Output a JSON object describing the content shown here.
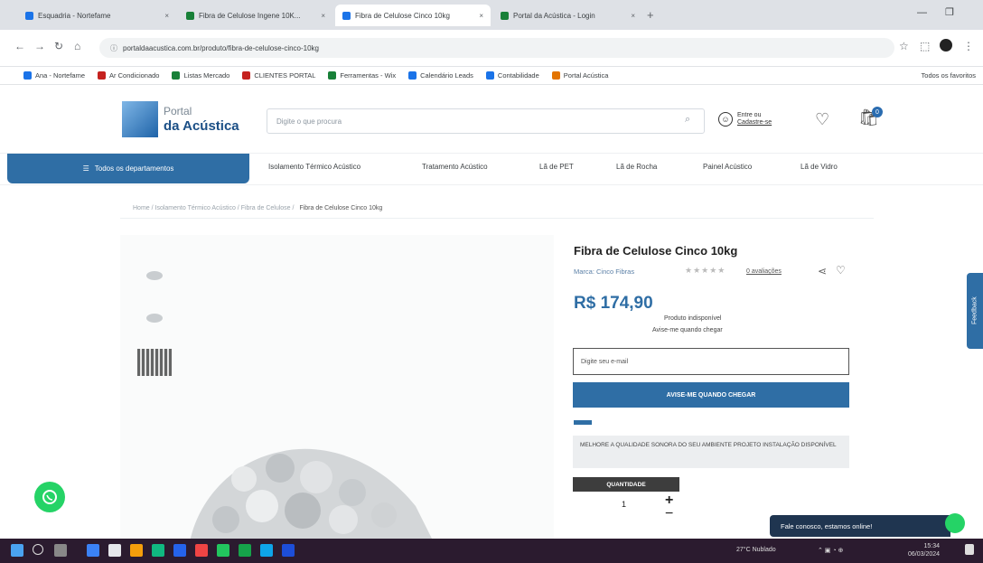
{
  "browser": {
    "tabs": [
      {
        "label": "Esquadria - Nortefame",
        "color": "#1a73e8"
      },
      {
        "label": "Fibra de Celulose Ingene 10K...",
        "color": "#188038"
      },
      {
        "label": "Fibra de Celulose Cinco 10kg",
        "color": "#1a73e8"
      },
      {
        "label": "Portal da Acústica - Login",
        "color": "#188038"
      }
    ],
    "new_tab": "+",
    "url": "portaldaacustica.com.br/produto/fibra-de-celulose-cinco-10kg",
    "bookmarks": [
      "Ana - Nortefame",
      "Ar Condicionado",
      "Listas Mercado",
      "CLIENTES PORTAL",
      "Ferramentas - Wix",
      "Calendário Leads",
      "Contabilidade",
      "Portal Acústica",
      "Todos os favoritos"
    ]
  },
  "header": {
    "logo_line1": "Portal",
    "logo_line2": "da Acústica",
    "search_placeholder": "Digite o que procura",
    "account_line1": "Entre ou",
    "account_line2": "Cadastre-se",
    "cart_count": "0"
  },
  "nav": {
    "departments": "Todos os departamentos",
    "items": [
      "Isolamento Térmico Acústico",
      "Tratamento Acústico",
      "Lã de PET",
      "Lã de Rocha",
      "Painel Acústico",
      "Lã de Vidro"
    ]
  },
  "breadcrumb": {
    "path": "Home / Isolamento Térmico Acústico / Fibra de Celulose / ",
    "current": "Fibra de Celulose Cinco 10kg"
  },
  "product": {
    "title": "Fibra de Celulose Cinco 10kg",
    "brand": "Marca: Cinco Fibras",
    "stars": "★★★★★",
    "reviews": "0 avaliações",
    "price": "R$ 174,90",
    "availability_line1": "Produto indisponível",
    "availability_line2": "Avise-me quando chegar",
    "notify_placeholder": "Digite seu e-mail",
    "notify_button": "AVISE-ME QUANDO CHEGAR",
    "info_text": "MELHORE A QUALIDADE SONORA DO SEU AMBIENTE PROJETO INSTALAÇÃO DISPONÍVEL",
    "quantity_label": "QUANTIDADE",
    "quantity": "1",
    "plus": "+",
    "minus": "−"
  },
  "widgets": {
    "feedback": "Feedback",
    "chat": "Fale conosco, estamos online!"
  },
  "taskbar": {
    "weather": "27°C  Nublado",
    "time": "15:34",
    "date": "06/03/2024"
  },
  "colors": {
    "primary": "#2f6ea5",
    "whatsapp": "#25d366"
  }
}
